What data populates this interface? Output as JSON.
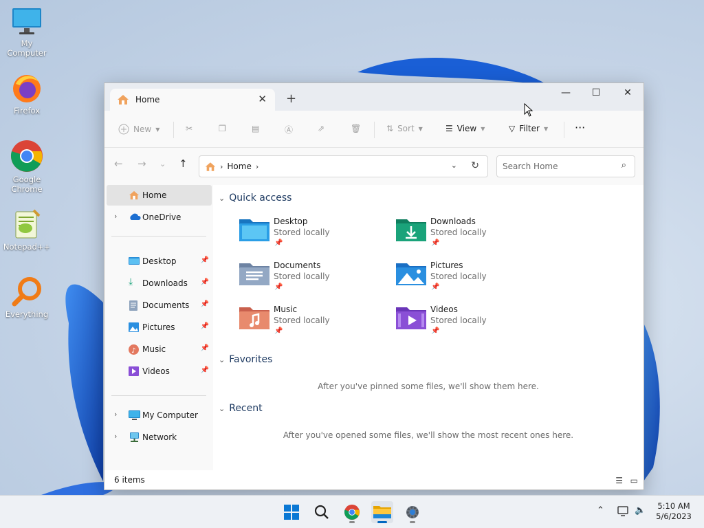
{
  "desktop": {
    "icons": [
      {
        "label": "My Computer",
        "icon": "monitor-icon"
      },
      {
        "label": "Firefox",
        "icon": "firefox-icon"
      },
      {
        "label": "Google Chrome",
        "icon": "chrome-icon"
      },
      {
        "label": "Notepad++",
        "icon": "notepadpp-icon"
      },
      {
        "label": "Everything",
        "icon": "everything-search-icon"
      }
    ]
  },
  "window": {
    "tab_title": "Home",
    "new_tab": "+",
    "controls": {
      "minimize": "—",
      "maximize": "☐",
      "close": "✕"
    }
  },
  "toolbar": {
    "new_label": "New",
    "sort_label": "Sort",
    "view_label": "View",
    "filter_label": "Filter",
    "more_label": "···",
    "disabled_icons": [
      "cut-icon",
      "copy-icon",
      "paste-icon",
      "rename-icon",
      "share-icon",
      "delete-icon"
    ]
  },
  "address": {
    "crumb": "Home",
    "search_placeholder": "Search Home"
  },
  "nav": {
    "home": "Home",
    "onedrive": "OneDrive",
    "pinned": [
      {
        "label": "Desktop",
        "icon": "desktop-folder-icon"
      },
      {
        "label": "Downloads",
        "icon": "downloads-arrow-icon"
      },
      {
        "label": "Documents",
        "icon": "documents-icon"
      },
      {
        "label": "Pictures",
        "icon": "pictures-icon"
      },
      {
        "label": "Music",
        "icon": "music-icon"
      },
      {
        "label": "Videos",
        "icon": "videos-icon"
      }
    ],
    "my_computer": "My Computer",
    "network": "Network"
  },
  "content": {
    "quick_access_title": "Quick access",
    "quick_access": [
      {
        "name": "Desktop",
        "sub": "Stored locally",
        "color": "#1e90d6"
      },
      {
        "name": "Downloads",
        "sub": "Stored locally",
        "color": "#1aa37a"
      },
      {
        "name": "Documents",
        "sub": "Stored locally",
        "color": "#8aa0bc"
      },
      {
        "name": "Pictures",
        "sub": "Stored locally",
        "color": "#2a8fe0"
      },
      {
        "name": "Music",
        "sub": "Stored locally",
        "color": "#e3785f"
      },
      {
        "name": "Videos",
        "sub": "Stored locally",
        "color": "#8a4fd6"
      }
    ],
    "favorites_title": "Favorites",
    "favorites_empty": "After you've pinned some files, we'll show them here.",
    "recent_title": "Recent",
    "recent_empty": "After you've opened some files, we'll show the most recent ones here."
  },
  "status": {
    "items": "6 items"
  },
  "taskbar": {
    "apps": [
      "windows-start-icon",
      "search-icon",
      "chrome-icon",
      "file-explorer-icon",
      "settings-gear-icon"
    ],
    "time": "5:10 AM",
    "date": "5/6/2023"
  },
  "colors": {
    "accent": "#0067c0",
    "window_bg": "#f3f3f3",
    "content_bg": "#ffffff"
  }
}
